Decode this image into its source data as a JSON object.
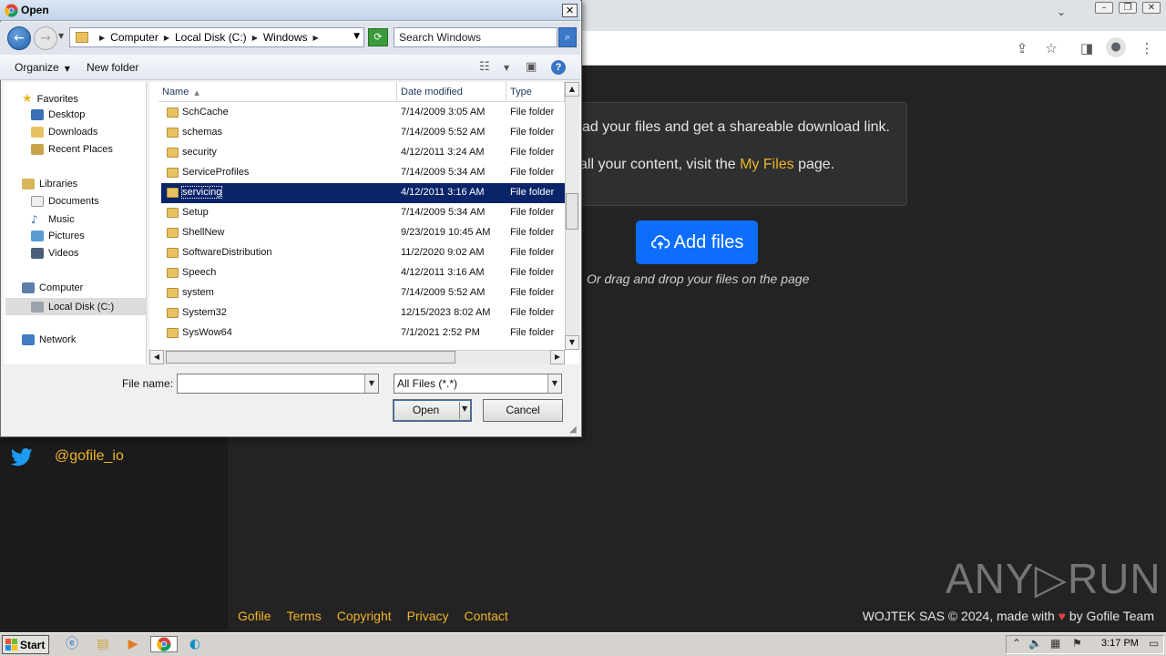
{
  "browser": {
    "toolbar_icons": [
      "share-icon",
      "star-icon",
      "sidebar-icon",
      "profile-icon",
      "menu-icon"
    ]
  },
  "page": {
    "info_line1": "ad your files and get a shareable download link.",
    "info_line2_prefix": "all your content, visit the ",
    "info_line2_link": "My Files",
    "info_line2_suffix": " page.",
    "add_files_label": "Add files",
    "drag_hint": "Or drag and drop your files on the page",
    "twitter_handle": "@gofile_io",
    "footer_links": [
      "Gofile",
      "Terms",
      "Copyright",
      "Privacy",
      "Contact"
    ],
    "footer_right_prefix": "WOJTEK SAS © 2024, made with",
    "footer_right_suffix": "by Gofile Team",
    "watermark": "ANY▷RUN",
    "accent_color": "#f0b429",
    "button_color": "#0d6efd"
  },
  "dialog": {
    "title": "Open",
    "breadcrumb": [
      "Computer",
      "Local Disk (C:)",
      "Windows"
    ],
    "search_placeholder": "Search Windows",
    "organize_label": "Organize",
    "new_folder_label": "New folder",
    "nav_pane": {
      "favorites": "Favorites",
      "desktop": "Desktop",
      "downloads": "Downloads",
      "recent": "Recent Places",
      "libraries": "Libraries",
      "documents": "Documents",
      "music": "Music",
      "pictures": "Pictures",
      "videos": "Videos",
      "computer": "Computer",
      "local_disk": "Local Disk (C:)",
      "network": "Network"
    },
    "columns": {
      "name": "Name",
      "date": "Date modified",
      "type": "Type"
    },
    "files": [
      {
        "name": "SchCache",
        "date": "7/14/2009 3:05 AM",
        "type": "File folder"
      },
      {
        "name": "schemas",
        "date": "7/14/2009 5:52 AM",
        "type": "File folder"
      },
      {
        "name": "security",
        "date": "4/12/2011 3:24 AM",
        "type": "File folder"
      },
      {
        "name": "ServiceProfiles",
        "date": "7/14/2009 5:34 AM",
        "type": "File folder"
      },
      {
        "name": "servicing",
        "date": "4/12/2011 3:16 AM",
        "type": "File folder"
      },
      {
        "name": "Setup",
        "date": "7/14/2009 5:34 AM",
        "type": "File folder"
      },
      {
        "name": "ShellNew",
        "date": "9/23/2019 10:45 AM",
        "type": "File folder"
      },
      {
        "name": "SoftwareDistribution",
        "date": "11/2/2020 9:02 AM",
        "type": "File folder"
      },
      {
        "name": "Speech",
        "date": "4/12/2011 3:16 AM",
        "type": "File folder"
      },
      {
        "name": "system",
        "date": "7/14/2009 5:52 AM",
        "type": "File folder"
      },
      {
        "name": "System32",
        "date": "12/15/2023 8:02 AM",
        "type": "File folder"
      },
      {
        "name": "SysWow64",
        "date": "7/1/2021 2:52 PM",
        "type": "File folder"
      }
    ],
    "selected_file": "servicing",
    "file_name_label": "File name:",
    "file_name_value": "",
    "file_type_value": "All Files (*.*)",
    "open_label": "Open",
    "cancel_label": "Cancel"
  },
  "taskbar": {
    "start_label": "Start",
    "clock": "3:17 PM"
  }
}
